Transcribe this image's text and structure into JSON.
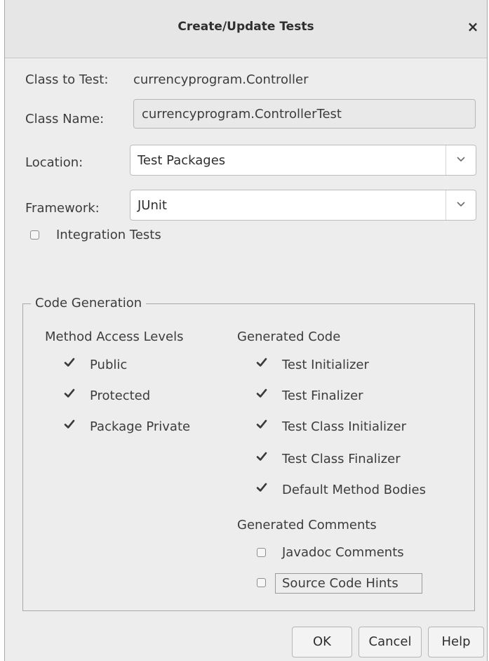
{
  "dialog": {
    "title": "Create/Update Tests",
    "close_icon": "close-icon"
  },
  "form": {
    "class_to_test_label": "Class to Test:",
    "class_to_test_value": "currencyprogram.Controller",
    "class_name_label": "Class Name:",
    "class_name_value": "currencyprogram.ControllerTest",
    "location_label": "Location:",
    "location_value": "Test Packages",
    "framework_label": "Framework:",
    "framework_value": "JUnit",
    "integration_tests": {
      "label": "Integration Tests",
      "checked": false
    }
  },
  "code_generation": {
    "title": "Code Generation",
    "method_access_levels": {
      "heading": "Method Access Levels",
      "items": [
        {
          "label": "Public",
          "checked": true
        },
        {
          "label": "Protected",
          "checked": true
        },
        {
          "label": "Package Private",
          "checked": true
        }
      ]
    },
    "generated_code": {
      "heading": "Generated Code",
      "items": [
        {
          "label": "Test Initializer",
          "checked": true
        },
        {
          "label": "Test Finalizer",
          "checked": true
        },
        {
          "label": "Test Class Initializer",
          "checked": true
        },
        {
          "label": "Test Class Finalizer",
          "checked": true
        },
        {
          "label": "Default Method Bodies",
          "checked": true
        }
      ]
    },
    "generated_comments": {
      "heading": "Generated Comments",
      "items": [
        {
          "label": "Javadoc Comments",
          "checked": false
        },
        {
          "label": "Source Code Hints",
          "checked": false
        }
      ]
    }
  },
  "buttons": {
    "ok": "OK",
    "cancel": "Cancel",
    "help": "Help"
  }
}
